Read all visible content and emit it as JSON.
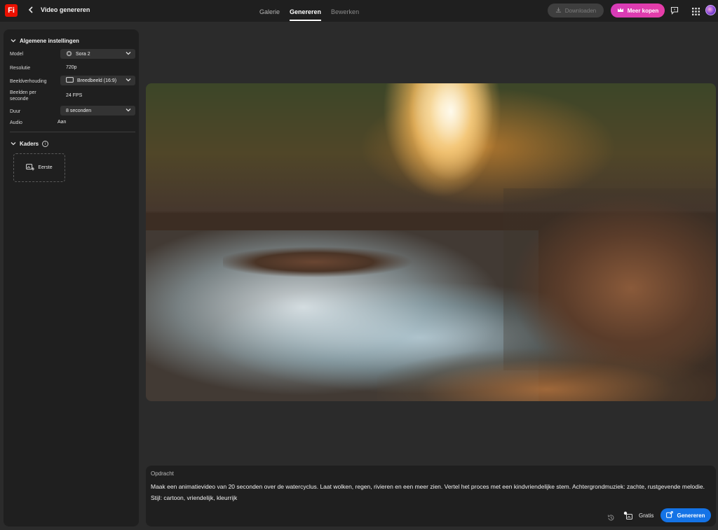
{
  "app": {
    "logo_text": "Fi",
    "title": "Video genereren"
  },
  "tabs": [
    {
      "label": "Galerie"
    },
    {
      "label": "Genereren"
    },
    {
      "label": "Bewerken"
    }
  ],
  "header_actions": {
    "download_label": "Downloaden",
    "buy_label": "Meer kopen"
  },
  "settings": {
    "section_title": "Algemene instellingen",
    "model_label": "Model",
    "model_value": "Sora 2",
    "resolution_label": "Resolutie",
    "resolution_value": "720p",
    "aspect_label": "Beeldverhouding",
    "aspect_value": "Breedbeeld (16:9)",
    "fps_label_line1": "Beelden per",
    "fps_label_line2": "seconde",
    "fps_value": "24 FPS",
    "duration_label": "Duur",
    "duration_value": "8 seconden",
    "audio_label": "Audio",
    "audio_value": "Aan"
  },
  "frames": {
    "section_title": "Kaders",
    "first_frame_label": "Eerste"
  },
  "prompt": {
    "label": "Opdracht",
    "text": "Maak een animatievideo van 20 seconden over de watercyclus. Laat wolken, regen, rivieren en een meer zien. Vertel het proces met een kindvriendelijke stem. Achtergrondmuziek: zachte, rustgevende melodie. Stijl: cartoon, vriendelijk, kleurrijk",
    "credit_label": "Gratis",
    "generate_label": "Genereren"
  },
  "colors": {
    "accent_blue": "#1473e6",
    "buy_pink": "#d73cb8",
    "logo_red": "#eb1000"
  }
}
